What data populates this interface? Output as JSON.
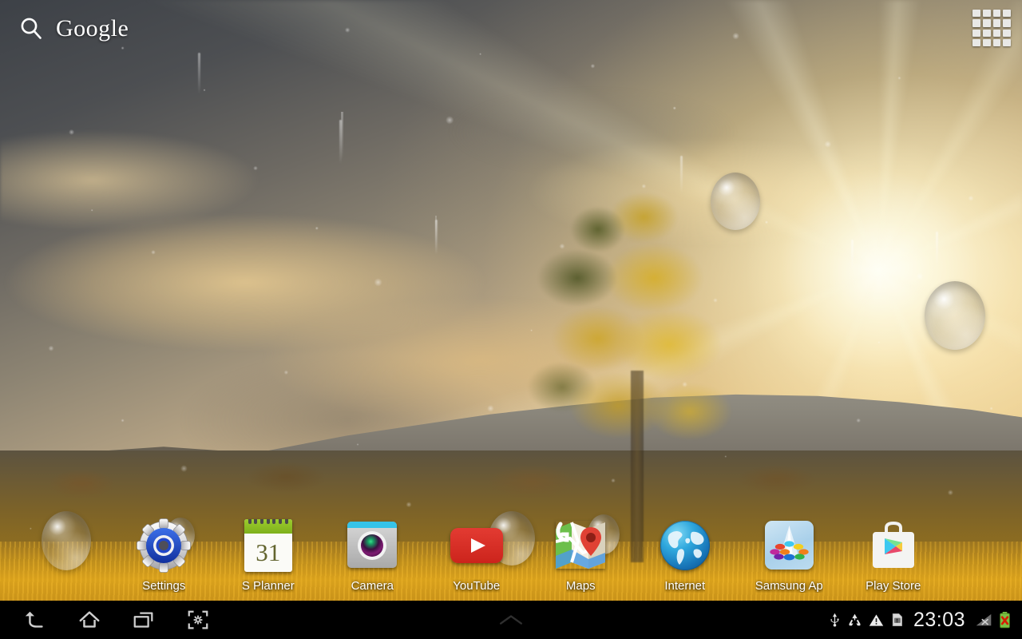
{
  "device": {
    "platform": "Android tablet home screen",
    "orientation": "landscape",
    "resolution": "1280x800"
  },
  "search_widget": {
    "icon": "search-icon",
    "label": "Google",
    "placeholder": "Google"
  },
  "apps_button": {
    "icon": "apps-grid-icon",
    "label": "Apps",
    "rows": 4,
    "columns": 4
  },
  "home_screen": {
    "apps": [
      {
        "label": "Settings",
        "icon": "settings-gear-icon"
      },
      {
        "label": "S Planner",
        "icon": "calendar-icon",
        "badge": "31"
      },
      {
        "label": "Camera",
        "icon": "camera-icon"
      },
      {
        "label": "YouTube",
        "icon": "youtube-icon"
      },
      {
        "label": "Maps",
        "icon": "maps-icon"
      },
      {
        "label": "Internet",
        "icon": "globe-icon"
      },
      {
        "label": "Samsung Ap",
        "icon": "samsung-apps-icon"
      },
      {
        "label": "Play Store",
        "icon": "play-store-icon"
      }
    ]
  },
  "navbar": {
    "buttons": [
      {
        "name": "back",
        "icon": "back-arrow-icon",
        "label": "Back"
      },
      {
        "name": "home",
        "icon": "home-icon",
        "label": "Home"
      },
      {
        "name": "recents",
        "icon": "recents-icon",
        "label": "Recent apps"
      },
      {
        "name": "screenshot",
        "icon": "screen-capture-icon",
        "label": "Screen capture"
      }
    ],
    "handle": {
      "icon": "chevron-up-icon",
      "label": "Notifications handle"
    }
  },
  "status_bar": {
    "time": "23:03",
    "icons": [
      {
        "name": "usb-icon",
        "label": "USB connected"
      },
      {
        "name": "recycle-icon",
        "label": "Sync / recycle"
      },
      {
        "name": "warning-icon",
        "label": "Warning"
      },
      {
        "name": "sim-card-alert-icon",
        "label": "No SIM card"
      },
      {
        "name": "signal-off-icon",
        "label": "No signal"
      },
      {
        "name": "battery-error-icon",
        "label": "Battery error"
      }
    ]
  },
  "colors": {
    "navbar_bg": "#000000",
    "status_text": "#f2f2f2",
    "label_text": "#ffffff",
    "accent_youtube": "#e33b32",
    "accent_planner": "#9ccc2e",
    "accent_camera": "#35c3e8",
    "accent_globe": "#2fa7dd",
    "accent_settings": "#2146c7",
    "battery_green": "#7ac143",
    "battery_alert": "#d81e05"
  },
  "wallpaper": {
    "description": "Rain drops on glass over a sunset landscape with a rainbow, golden clouds, sun rays, an autumn tree and a mountain ridge"
  }
}
